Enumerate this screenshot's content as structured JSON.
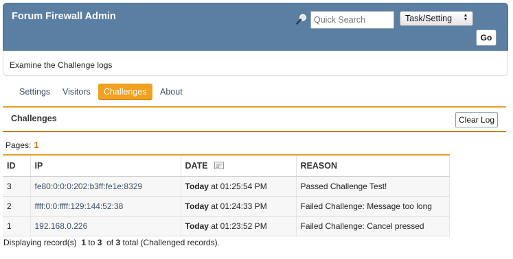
{
  "header": {
    "title": "Forum Firewall Admin",
    "search_placeholder": "Quick Search",
    "search_icon": "search-icon",
    "task_select_value": "Task/Setting",
    "go_label": "Go"
  },
  "description": "Examine the Challenge logs",
  "tabs": [
    {
      "label": "Settings",
      "active": false
    },
    {
      "label": "Visitors",
      "active": false
    },
    {
      "label": "Challenges",
      "active": true
    },
    {
      "label": "About",
      "active": false
    }
  ],
  "panel": {
    "title": "Challenges",
    "clear_label": "Clear Log"
  },
  "pages": {
    "label": "Pages:",
    "current": "1"
  },
  "table": {
    "columns": [
      "ID",
      "IP",
      "DATE",
      "REASON"
    ],
    "rows": [
      {
        "id": "3",
        "ip": "fe80:0:0:0:202:b3ff:fe1e:8329",
        "day": "Today",
        "time": "at 01:25:54 PM",
        "reason": "Passed Challenge Test!"
      },
      {
        "id": "2",
        "ip": "ffff:0:0:ffff:129:144:52:38",
        "day": "Today",
        "time": "at 01:24:33 PM",
        "reason": "Failed Challenge: Message too long"
      },
      {
        "id": "1",
        "ip": "192.168.0.226",
        "day": "Today",
        "time": "at 01:23:52 PM",
        "reason": "Failed Challenge: Cancel pressed"
      }
    ]
  },
  "footer": {
    "prefix": "Displaying record(s)",
    "from": "1",
    "to_word": "to",
    "to": "3",
    "of_word": "of",
    "total": "3",
    "suffix": "total (Challenged records)."
  },
  "colors": {
    "header_bg": "#5b7fa3",
    "accent": "#f1a01f",
    "link": "#3b4f68"
  }
}
